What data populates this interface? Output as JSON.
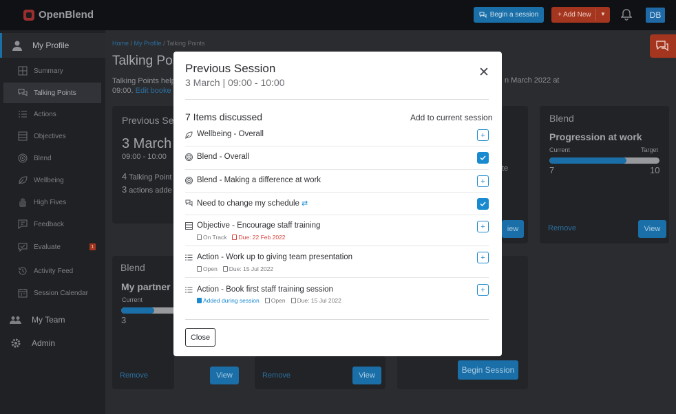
{
  "app": {
    "name": "OpenBlend"
  },
  "topbar": {
    "begin_session_label": "Begin a session",
    "add_new_label": "+ Add New",
    "avatar_initials": "DB"
  },
  "sidebar": {
    "profile_label": "My Profile",
    "items": [
      {
        "label": "Summary",
        "icon": "grid-icon"
      },
      {
        "label": "Talking Points",
        "icon": "chat-icon"
      },
      {
        "label": "Actions",
        "icon": "checklist-icon"
      },
      {
        "label": "Objectives",
        "icon": "objectives-icon"
      },
      {
        "label": "Blend",
        "icon": "target-icon"
      },
      {
        "label": "Wellbeing",
        "icon": "leaf-icon"
      },
      {
        "label": "High Fives",
        "icon": "hand-icon"
      },
      {
        "label": "Feedback",
        "icon": "feedback-icon"
      },
      {
        "label": "Evaluate",
        "icon": "evaluate-icon",
        "badge": "1"
      },
      {
        "label": "Activity Feed",
        "icon": "history-icon"
      },
      {
        "label": "Session Calendar",
        "icon": "calendar-icon"
      }
    ],
    "team_label": "My Team",
    "admin_label": "Admin"
  },
  "breadcrumb": {
    "home": "Home",
    "profile": "My Profile",
    "current": "Talking Points"
  },
  "main": {
    "title": "Talking Poi",
    "desc_line1": "Talking Points help",
    "desc_time": "09:00.",
    "desc_link": "Edit booke",
    "desc_right": "n March 2022 at"
  },
  "background_cards": {
    "prev_session_heading": "Previous Se",
    "prev_session_date": "3 March",
    "prev_session_time": "09:00 - 10:00",
    "talking_points_count": "4",
    "talking_points_text": "Talking Point",
    "actions_count": "3",
    "actions_text": "actions adde",
    "middle_fragment": "te",
    "view_label": "View",
    "view_fragment": "iew",
    "remove_label": "Remove",
    "blend_card_1": {
      "heading": "Blend",
      "title": "Progression at work",
      "current_label": "Current",
      "target_label": "Target",
      "current": "7",
      "target": "10",
      "progress": 0.7
    },
    "blend_card_2": {
      "heading": "Blend",
      "title": "My partner",
      "current_label": "Current",
      "current": "3",
      "progress": 0.3
    },
    "begin_session_label": "Begin Session"
  },
  "modal": {
    "title": "Previous Session",
    "subtitle": "3 March | 09:00 - 10:00",
    "count_label": "7 Items discussed",
    "add_to_current_label": "Add to current session",
    "close_label": "Close",
    "items": [
      {
        "label": "Wellbeing - Overall",
        "icon": "leaf-icon",
        "checked": false
      },
      {
        "label": "Blend - Overall",
        "icon": "target-icon",
        "checked": true
      },
      {
        "label": "Blend - Making a difference at work",
        "icon": "target-icon",
        "checked": false
      },
      {
        "label": "Need to change my schedule",
        "icon": "chat-icon",
        "checked": true,
        "recurring": true
      },
      {
        "label": "Objective - Encourage staff training",
        "icon": "objectives-icon",
        "checked": false,
        "meta": {
          "status": "On Track",
          "due": "Due: 22 Feb 2022"
        }
      },
      {
        "label": "Action - Work up to giving team presentation",
        "icon": "checklist-icon",
        "checked": false,
        "meta": {
          "status": "Open",
          "due": "Due: 15 Jul 2022"
        }
      },
      {
        "label": "Action - Book first staff training session",
        "icon": "checklist-icon",
        "checked": false,
        "meta": {
          "added": "Added during session",
          "status": "Open",
          "due": "Due: 15 Jul 2022"
        }
      }
    ]
  },
  "colors": {
    "accent": "#1a8ad0",
    "brand_red": "#a4351f",
    "overdue": "#d6423d"
  }
}
